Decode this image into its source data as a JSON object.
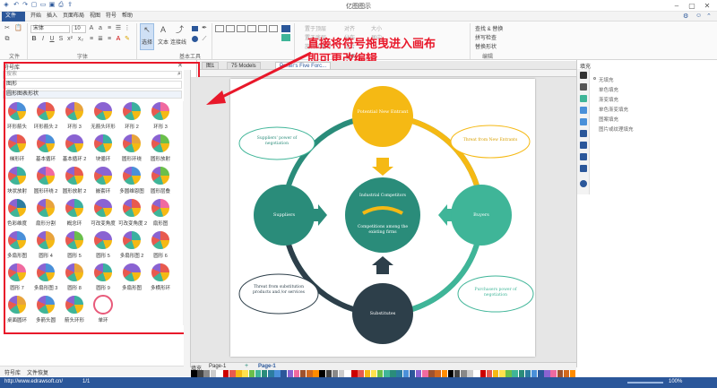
{
  "app": {
    "title": "亿图图示"
  },
  "menu": {
    "items": [
      "文件",
      "开始",
      "插入",
      "页面布局",
      "视图",
      "符号",
      "帮助"
    ]
  },
  "ribbon": {
    "font_name": "宋体",
    "font_size": "10",
    "groups": {
      "file": "文件",
      "font": "字体",
      "basic_tools": "基本工具",
      "arrange": "排列",
      "edit": "编辑"
    },
    "tools": {
      "select": "选择",
      "text": "文本",
      "connector": "连接线"
    },
    "arrange_items": [
      "置于顶层",
      "置于底层",
      "旋转和翻转",
      "对齐",
      "分布",
      "组合",
      "大小",
      "居中"
    ],
    "edit_items": [
      "查找 & 替换",
      "拼写检查",
      "替换形状"
    ]
  },
  "left_panel": {
    "title": "符号库",
    "search_placeholder": "搜索",
    "category": "圆形图表形状",
    "library": "图形",
    "bottom_tabs": [
      "符号库",
      "文件恢复"
    ],
    "symbols": [
      {
        "label": "环形箭头",
        "color": "#4a90d9"
      },
      {
        "label": "环形箭头 2",
        "color": "#e85a4f"
      },
      {
        "label": "环形 3",
        "color": "#e8a33c"
      },
      {
        "label": "无箭头环形",
        "color": "#8a63d2"
      },
      {
        "label": "环形 2",
        "color": "#3bb0a0"
      },
      {
        "label": "环形 3",
        "color": "#f06aa0"
      },
      {
        "label": "梯形环",
        "color": "#e85a4f"
      },
      {
        "label": "基本循环",
        "color": "#4a90d9"
      },
      {
        "label": "基本循环 2",
        "color": "#8a63d2"
      },
      {
        "label": "块循环",
        "color": "#3bb0a0"
      },
      {
        "label": "圆形环绕",
        "color": "#e8a33c"
      },
      {
        "label": "圆形放射",
        "color": "#6abf4b"
      },
      {
        "label": "块状放射",
        "color": "#3bb0a0"
      },
      {
        "label": "圆形环绕 2",
        "color": "#f06aa0"
      },
      {
        "label": "圆形放射 2",
        "color": "#e85a4f"
      },
      {
        "label": "嵌套环",
        "color": "#8a63d2"
      },
      {
        "label": "多圆维恩图",
        "color": "#4a90d9"
      },
      {
        "label": "圆形层叠",
        "color": "#6abf4b"
      },
      {
        "label": "色彩维度",
        "color": "#2c7da0"
      },
      {
        "label": "扇形分割",
        "color": "#e8a33c"
      },
      {
        "label": "概念环",
        "color": "#3bb0a0"
      },
      {
        "label": "可改变角度",
        "color": "#8a63d2"
      },
      {
        "label": "可改变角度 2",
        "color": "#e85a4f"
      },
      {
        "label": "扇形图",
        "color": "#f06aa0"
      },
      {
        "label": "多扇形图",
        "color": "#4a90d9"
      },
      {
        "label": "圆形 4",
        "color": "#e8a33c"
      },
      {
        "label": "圆形 5",
        "color": "#6abf4b"
      },
      {
        "label": "圆形 5",
        "color": "#8a63d2"
      },
      {
        "label": "多扇形图 2",
        "color": "#3bb0a0"
      },
      {
        "label": "圆形 6",
        "color": "#e85a4f"
      },
      {
        "label": "圆形 7",
        "color": "#f06aa0"
      },
      {
        "label": "多扇形图 3",
        "color": "#4a90d9"
      },
      {
        "label": "圆形 8",
        "color": "#e8a33c"
      },
      {
        "label": "圆形 9",
        "color": "#3bb0a0"
      },
      {
        "label": "多扇形图",
        "color": "#8a63d2"
      },
      {
        "label": "多横形环",
        "color": "#e85a4f"
      },
      {
        "label": "桌面圆环",
        "color": "#e8a33c"
      },
      {
        "label": "多箭头圆",
        "color": "#4a90d9"
      },
      {
        "label": "箭头环形",
        "color": "#3bb0a0"
      },
      {
        "label": "单环",
        "color": "#ffffff"
      }
    ]
  },
  "tabs": [
    "图1",
    "75 Models",
    "Porter's Five Forc..."
  ],
  "diagram": {
    "center": {
      "title": "Industrial Competitors",
      "subtitle": "Competitions among the existing firms"
    },
    "top": "Potential New Entrant",
    "left": "Suppliers",
    "right": "Buyers",
    "bottom": "Substitutes",
    "bubble_tl": "Suppliers' power of negotiation",
    "bubble_tr": "Threat from New Entrants",
    "bubble_bl": "Threat from substitution products and /or services",
    "bubble_br": "Purchasers power of negotiation",
    "colors": {
      "top": "#f5b914",
      "side": "#2a8c7a",
      "right": "#3fb598",
      "bottom": "#2d3f4a",
      "center": "#2a8c7a"
    }
  },
  "annotation": {
    "line1": "直接将符号拖曳进入画布",
    "line2": "即可更改编辑"
  },
  "right_panel": {
    "title": "填充",
    "options": [
      "无填充",
      "单色填充",
      "渐变填充",
      "单色渐变填充",
      "图案填充",
      "图片或纹理填充"
    ]
  },
  "page_bar": {
    "page_tab": "Page-1",
    "active_page": "Page-1",
    "label": "填充"
  },
  "status": {
    "url": "http://www.edrawsoft.cn/",
    "page_num": "1/1",
    "zoom": "100%"
  }
}
